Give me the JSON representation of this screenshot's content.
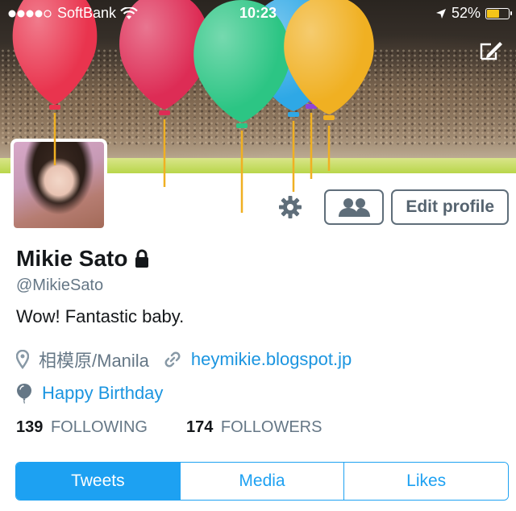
{
  "status_bar": {
    "carrier": "SoftBank",
    "time": "10:23",
    "battery": "52%",
    "battery_level": 0.52,
    "icons": [
      "signal-dots-icon",
      "wifi-icon",
      "location-arrow-icon",
      "battery-icon"
    ]
  },
  "header": {
    "compose_icon": "compose-icon",
    "balloon_colors": [
      "#e9344e",
      "#dd2c55",
      "#2cc584",
      "#2ea8e6",
      "#8f43d8",
      "#f0b022"
    ]
  },
  "actions": {
    "settings_icon": "gear-icon",
    "follow_icon": "people-icon",
    "edit_profile": "Edit profile"
  },
  "profile": {
    "name": "Mikie Sato",
    "lock_icon": "lock-icon",
    "handle": "@MikieSato",
    "bio": "Wow! Fantastic baby.",
    "location": "相模原/Manila",
    "website": "heymikie.blogspot.jp",
    "birthday": "Happy Birthday"
  },
  "stats": {
    "following_count": "139",
    "following_label": "FOLLOWING",
    "followers_count": "174",
    "followers_label": "FOLLOWERS"
  },
  "tabs": [
    {
      "label": "Tweets",
      "active": true
    },
    {
      "label": "Media",
      "active": false
    },
    {
      "label": "Likes",
      "active": false
    }
  ],
  "colors": {
    "accent": "#1da1f2",
    "link": "#1b95e0",
    "secondary_text": "#657786",
    "battery_fill": "#f5c518"
  }
}
